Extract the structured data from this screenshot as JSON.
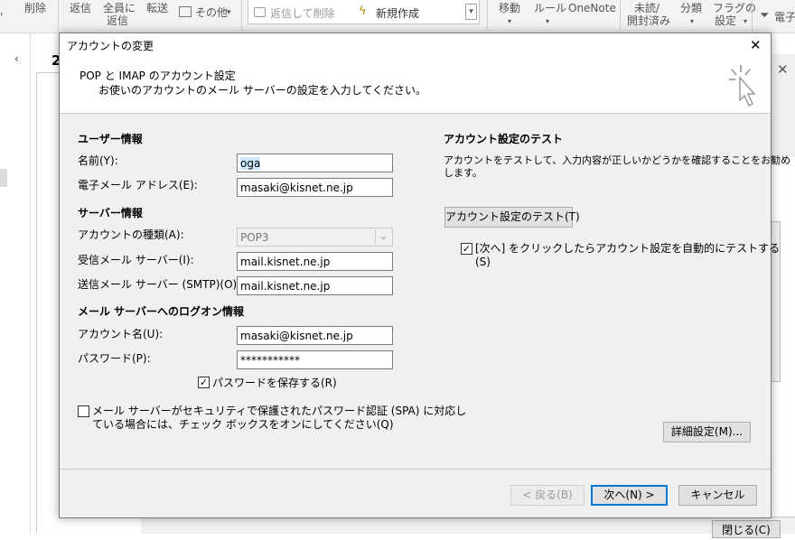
{
  "ribbon": {
    "delete": "削除",
    "reply": "返信",
    "reply_all_1": "全員に",
    "reply_all_2": "返信",
    "forward": "転送",
    "other": "その他",
    "reply_delete": "返信して削除",
    "new_create": "新規作成",
    "move": "移動",
    "rules": "ルール",
    "onenote": "OneNote",
    "unread_1": "未読/",
    "unread_2": "開封済み",
    "categorize": "分類",
    "flag_1": "フラグの",
    "flag_2": "設定",
    "email_partial": "電子",
    "left_number": "2"
  },
  "background": {
    "close_button_partial": "閉じる(C)"
  },
  "dialog": {
    "title": "アカウントの変更",
    "close_glyph": "✕",
    "header_title": "POP と IMAP のアカウント設定",
    "header_subtitle": "お使いのアカウントのメール サーバーの設定を入力してください。",
    "user_info": {
      "heading": "ユーザー情報",
      "name_label": "名前(Y):",
      "name_value": "oga",
      "email_label": "電子メール アドレス(E):",
      "email_value": "masaki@kisnet.ne.jp"
    },
    "server_info": {
      "heading": "サーバー情報",
      "account_type_label": "アカウントの種類(A):",
      "account_type_value": "POP3",
      "incoming_label": "受信メール サーバー(I):",
      "incoming_value": "mail.kisnet.ne.jp",
      "outgoing_label": "送信メール サーバー (SMTP)(O):",
      "outgoing_value": "mail.kisnet.ne.jp"
    },
    "logon_info": {
      "heading": "メール サーバーへのログオン情報",
      "account_name_label": "アカウント名(U):",
      "account_name_value": "masaki@kisnet.ne.jp",
      "password_label": "パスワード(P):",
      "password_value": "***********",
      "save_password_label": "パスワードを保存する(R)",
      "save_password_checked": true,
      "spa_line1": "メール サーバーがセキュリティで保護されたパスワード認証 (SPA) に対応し",
      "spa_line2": "ている場合には、チェック ボックスをオンにしてください(Q)",
      "spa_checked": false
    },
    "test": {
      "heading": "アカウント設定のテスト",
      "desc_line1": "アカウントをテストして、入力内容が正しいかどうかを確認することをお勧め",
      "desc_line2": "します。",
      "test_button": "アカウント設定のテスト(T)",
      "auto_test_line1": "[次へ] をクリックしたらアカウント設定を自動的にテストする",
      "auto_test_line2": "(S)",
      "auto_test_checked": true
    },
    "more_settings_button": "詳細設定(M)...",
    "back_button": "< 戻る(B)",
    "next_button": "次へ(N) >",
    "cancel_button": "キャンセル",
    "check_glyph": "✓",
    "dropdown_glyph": "⌄"
  }
}
